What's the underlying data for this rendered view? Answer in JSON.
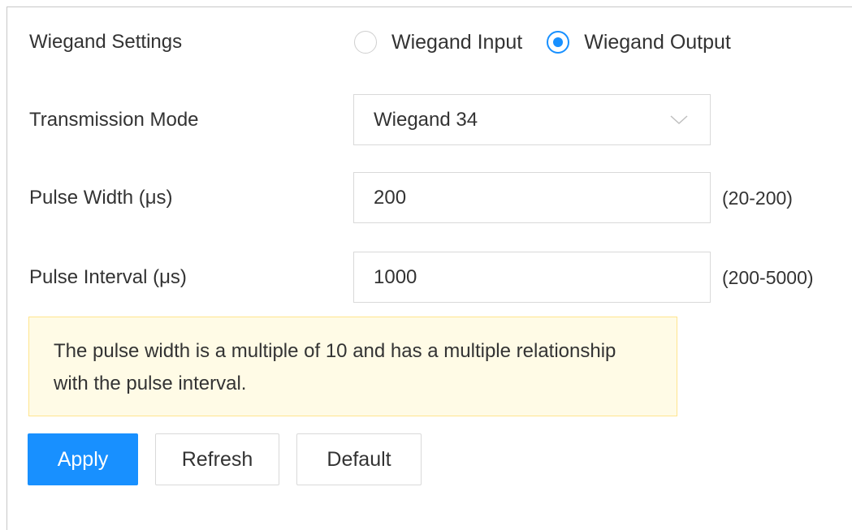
{
  "wiegand_settings": {
    "label": "Wiegand Settings",
    "options": [
      {
        "label": "Wiegand Input",
        "checked": false
      },
      {
        "label": "Wiegand Output",
        "checked": true
      }
    ]
  },
  "transmission_mode": {
    "label": "Transmission Mode",
    "value": "Wiegand 34",
    "icon": "chevron-down-icon"
  },
  "pulse_width": {
    "label": "Pulse Width (μs)",
    "value": "200",
    "range": "(20-200)"
  },
  "pulse_interval": {
    "label": "Pulse Interval (μs)",
    "value": "1000",
    "range": "(200-5000)"
  },
  "notice": {
    "text": "The pulse width is a multiple of 10 and has a multiple relationship with the pulse interval."
  },
  "buttons": {
    "apply": "Apply",
    "refresh": "Refresh",
    "default": "Default"
  },
  "colors": {
    "accent": "#1890ff",
    "notice_bg": "#fffbe6",
    "notice_border": "#ffe58f"
  }
}
